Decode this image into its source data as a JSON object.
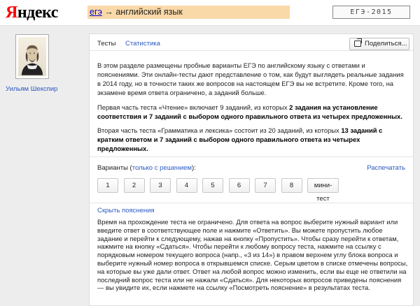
{
  "header": {
    "logo_first": "Я",
    "logo_rest": "ндекс",
    "crumb_link": "егэ",
    "crumb_arrow": " → ",
    "crumb_title": "английский язык",
    "badge": "ЕГЭ-2015"
  },
  "sidebar": {
    "author_name": "Уильям Шекспир"
  },
  "tabs": {
    "tests": "Тесты",
    "stats": "Статистика",
    "share": "Поделиться..."
  },
  "description": {
    "p1": "В этом разделе размещены пробные варианты ЕГЭ по английскому языку с ответами и пояснениями. Эти онлайн-тесты дают представление о том, как будут выглядеть реальные задания в 2014 году, но в точности таких же вопросов на настоящем ЕГЭ вы не встретите. Кроме того, на экзамене время ответа ограничено, а заданий больше.",
    "p2_text": "Первая часть теста «Чтение» включает 9 заданий, из которых ",
    "p2_bold": "2 задания на установление соответствия и 7 заданий с выбором одного правильного ответа из четырех предложенных.",
    "p3_text": "Вторая часть теста «Грамматика и лексика» состоит из 20 заданий, из которых ",
    "p3_bold": "13 заданий с кратким ответом и 7 заданий с выбором одного правильного ответа из четырех предложенных."
  },
  "variants": {
    "label": "Варианты (",
    "solved_link": "только с решением",
    "label_end": "):",
    "print_link": "Распечатать",
    "buttons": [
      "1",
      "2",
      "3",
      "4",
      "5",
      "6",
      "7",
      "8"
    ],
    "mini_test": "мини-тест"
  },
  "explanation": {
    "hide_link": "Скрыть пояснения",
    "text": "Время на прохождение теста не ограничено. Для ответа на вопрос выберите нужный вариант или введите ответ в соответствующее поле и нажмите «Ответить». Вы можете пропустить любое задание и перейти к следующему, нажав на кнопку «Пропустить». Чтобы сразу перейти к ответам, нажмите на кнопку «Сдаться». Чтобы перейти к любому вопросу теста, нажмите на ссылку с порядковым номером текущего вопроса (напр., «3 из 14») в правом верхнем углу блока вопроса и выберите нужный номер вопроса в открывшемся списке. Серым цветом в списке отмечены вопросы, на которые вы уже дали ответ. Ответ на любой вопрос можно изменить, если вы еще не ответили на последний вопрос теста или не нажали «Сдаться». Для некоторых вопросов приведены пояснения — вы увидите их, если нажмете на ссылку «Посмотреть пояснение» в результатах теста."
  },
  "icons": {
    "share": "share-icon",
    "portrait": "shakespeare-portrait"
  },
  "colors": {
    "logo_red": "#ff0000",
    "crumb_bg": "#fad9a8",
    "link_blue": "#2a59c0"
  }
}
